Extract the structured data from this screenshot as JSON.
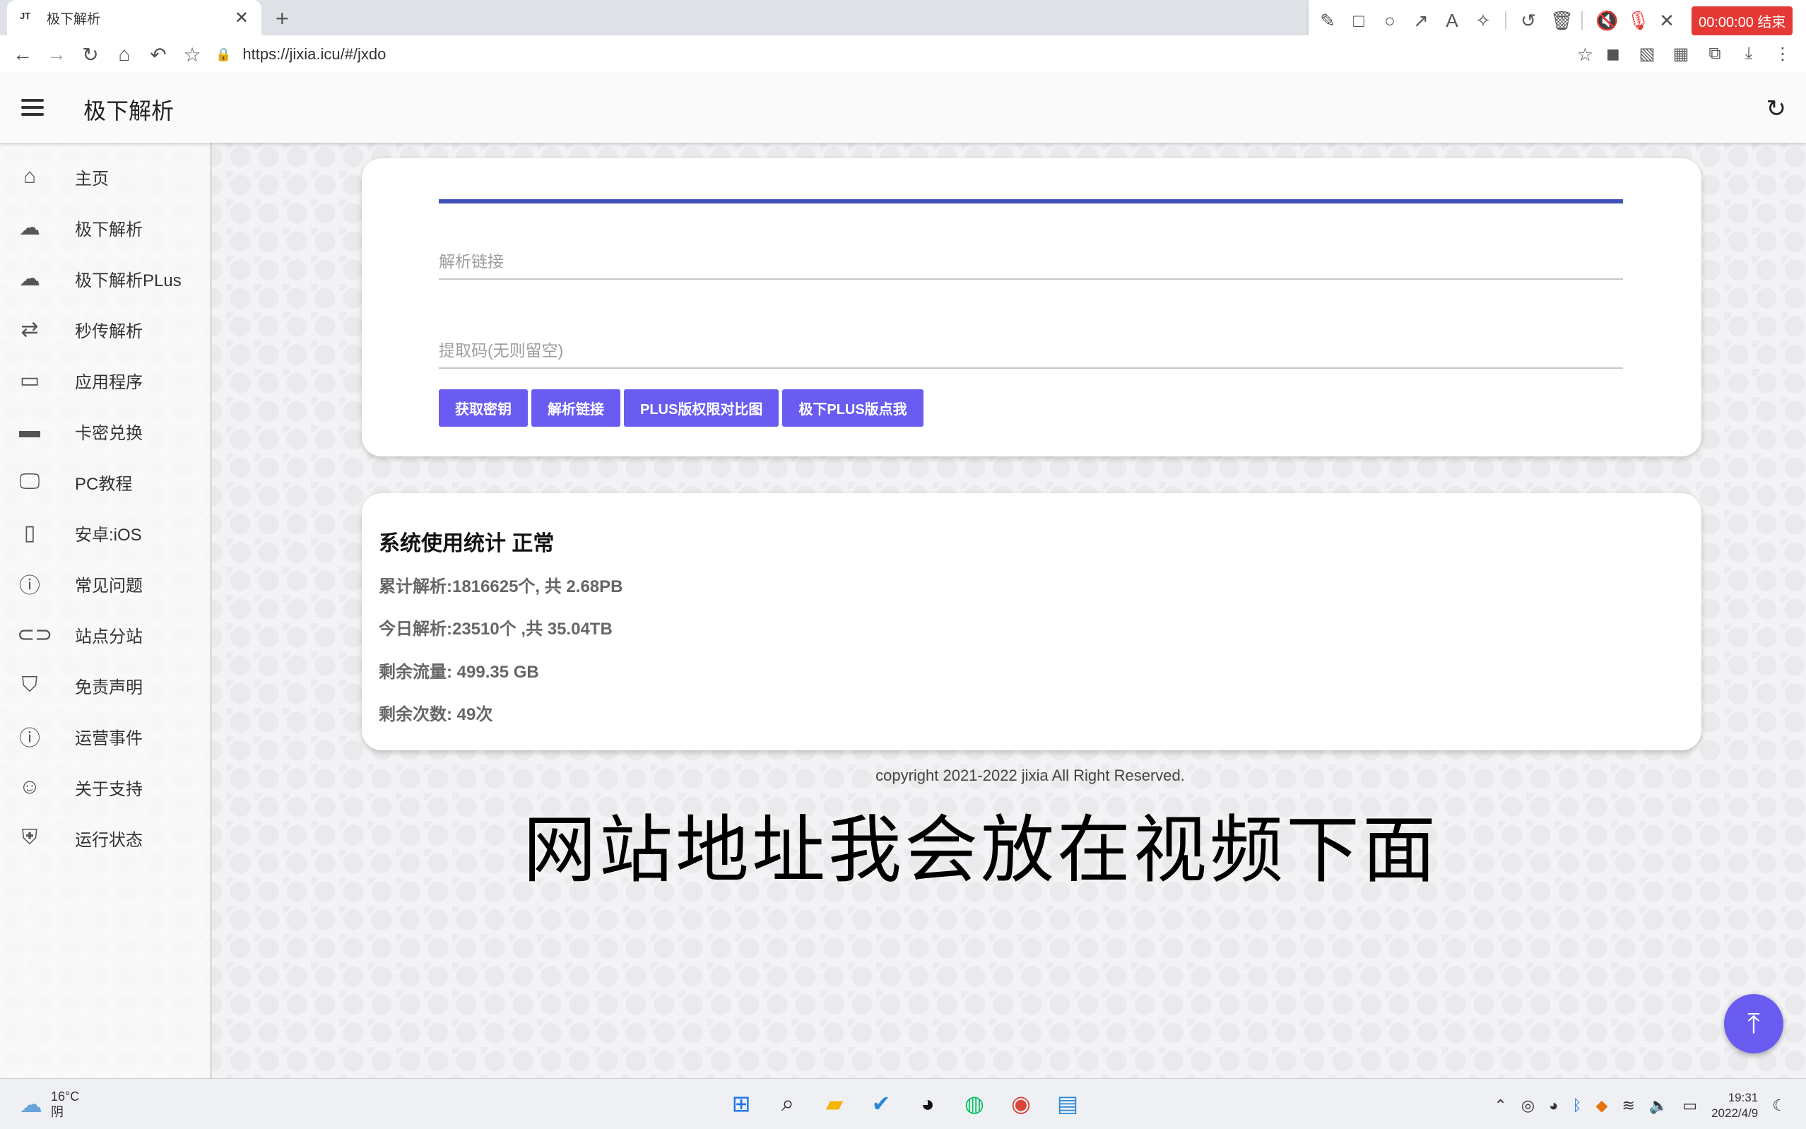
{
  "browser": {
    "tab_title": "极下解析",
    "favicon_text": "JT",
    "url": "https://jixia.icu/#/jxdo"
  },
  "recorder": {
    "timer": "00:00:00 结束"
  },
  "appbar": {
    "title": "极下解析"
  },
  "sidebar": {
    "items": [
      {
        "label": "主页",
        "icon": "home-icon"
      },
      {
        "label": "极下解析",
        "icon": "cloud-icon"
      },
      {
        "label": "极下解析PLus",
        "icon": "cloud-icon"
      },
      {
        "label": "秒传解析",
        "icon": "repeat-icon"
      },
      {
        "label": "应用程序",
        "icon": "laptop-icon"
      },
      {
        "label": "卡密兑换",
        "icon": "credit-card-icon"
      },
      {
        "label": "PC教程",
        "icon": "monitor-icon"
      },
      {
        "label": "安卓:iOS",
        "icon": "phone-icon"
      },
      {
        "label": "常见问题",
        "icon": "help-icon"
      },
      {
        "label": "站点分站",
        "icon": "link-icon"
      },
      {
        "label": "免责声明",
        "icon": "bookmark-icon"
      },
      {
        "label": "运营事件",
        "icon": "alert-icon"
      },
      {
        "label": "关于支持",
        "icon": "smile-icon"
      },
      {
        "label": "运行状态",
        "icon": "shield-icon"
      }
    ]
  },
  "form": {
    "link_placeholder": "解析链接",
    "code_placeholder": "提取码(无则留空)",
    "buttons": {
      "get_key": "获取密钥",
      "parse_link": "解析链接",
      "plus_compare": "PLUS版权限对比图",
      "plus_go": "极下PLUS版点我"
    }
  },
  "stats": {
    "title": "系统使用统计  正常",
    "total": "累计解析:1816625个, 共 2.68PB",
    "today": "今日解析:23510个 ,共 35.04TB",
    "remaining_traffic": "剩余流量: 499.35 GB",
    "remaining_count": "剩余次数: 49次"
  },
  "footer": {
    "copyright": "copyright 2021-2022 jixia All Right Reserved."
  },
  "caption": "网站地址我会放在视频下面",
  "taskbar": {
    "temperature": "16°C",
    "weather": "阴",
    "time": "19:31",
    "date": "2022/4/9"
  },
  "colors": {
    "accent": "#3f51b5",
    "button": "#6a5cf0",
    "record_red": "#e53935"
  }
}
